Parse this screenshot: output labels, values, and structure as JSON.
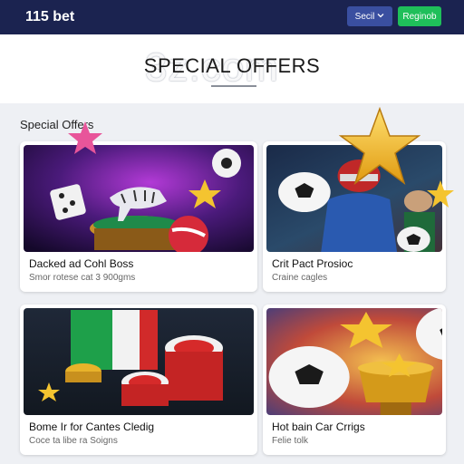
{
  "header": {
    "brand": "115 bet",
    "select_label": "Secil",
    "register_label": "Reginob"
  },
  "hero": {
    "watermark": "3z.com",
    "title": "SPECIAL OFFERS"
  },
  "section": {
    "title": "Special Offers"
  },
  "cards": [
    {
      "title": "Dacked ad Cohl Boss",
      "subtitle": "Smor rotese cat 3 900gms"
    },
    {
      "title": "Crit Pact Prosioc",
      "subtitle": "Craine cagles"
    },
    {
      "title": "Bome Ir for Cantes Cledig",
      "subtitle": "Coce ta libe ra Soigns"
    },
    {
      "title": "Hot bain Car Crrigs",
      "subtitle": "Felie tolk"
    }
  ],
  "colors": {
    "topbar": "#1b2350",
    "select_button": "#3a4fa0",
    "register_button": "#1fbf5a"
  }
}
